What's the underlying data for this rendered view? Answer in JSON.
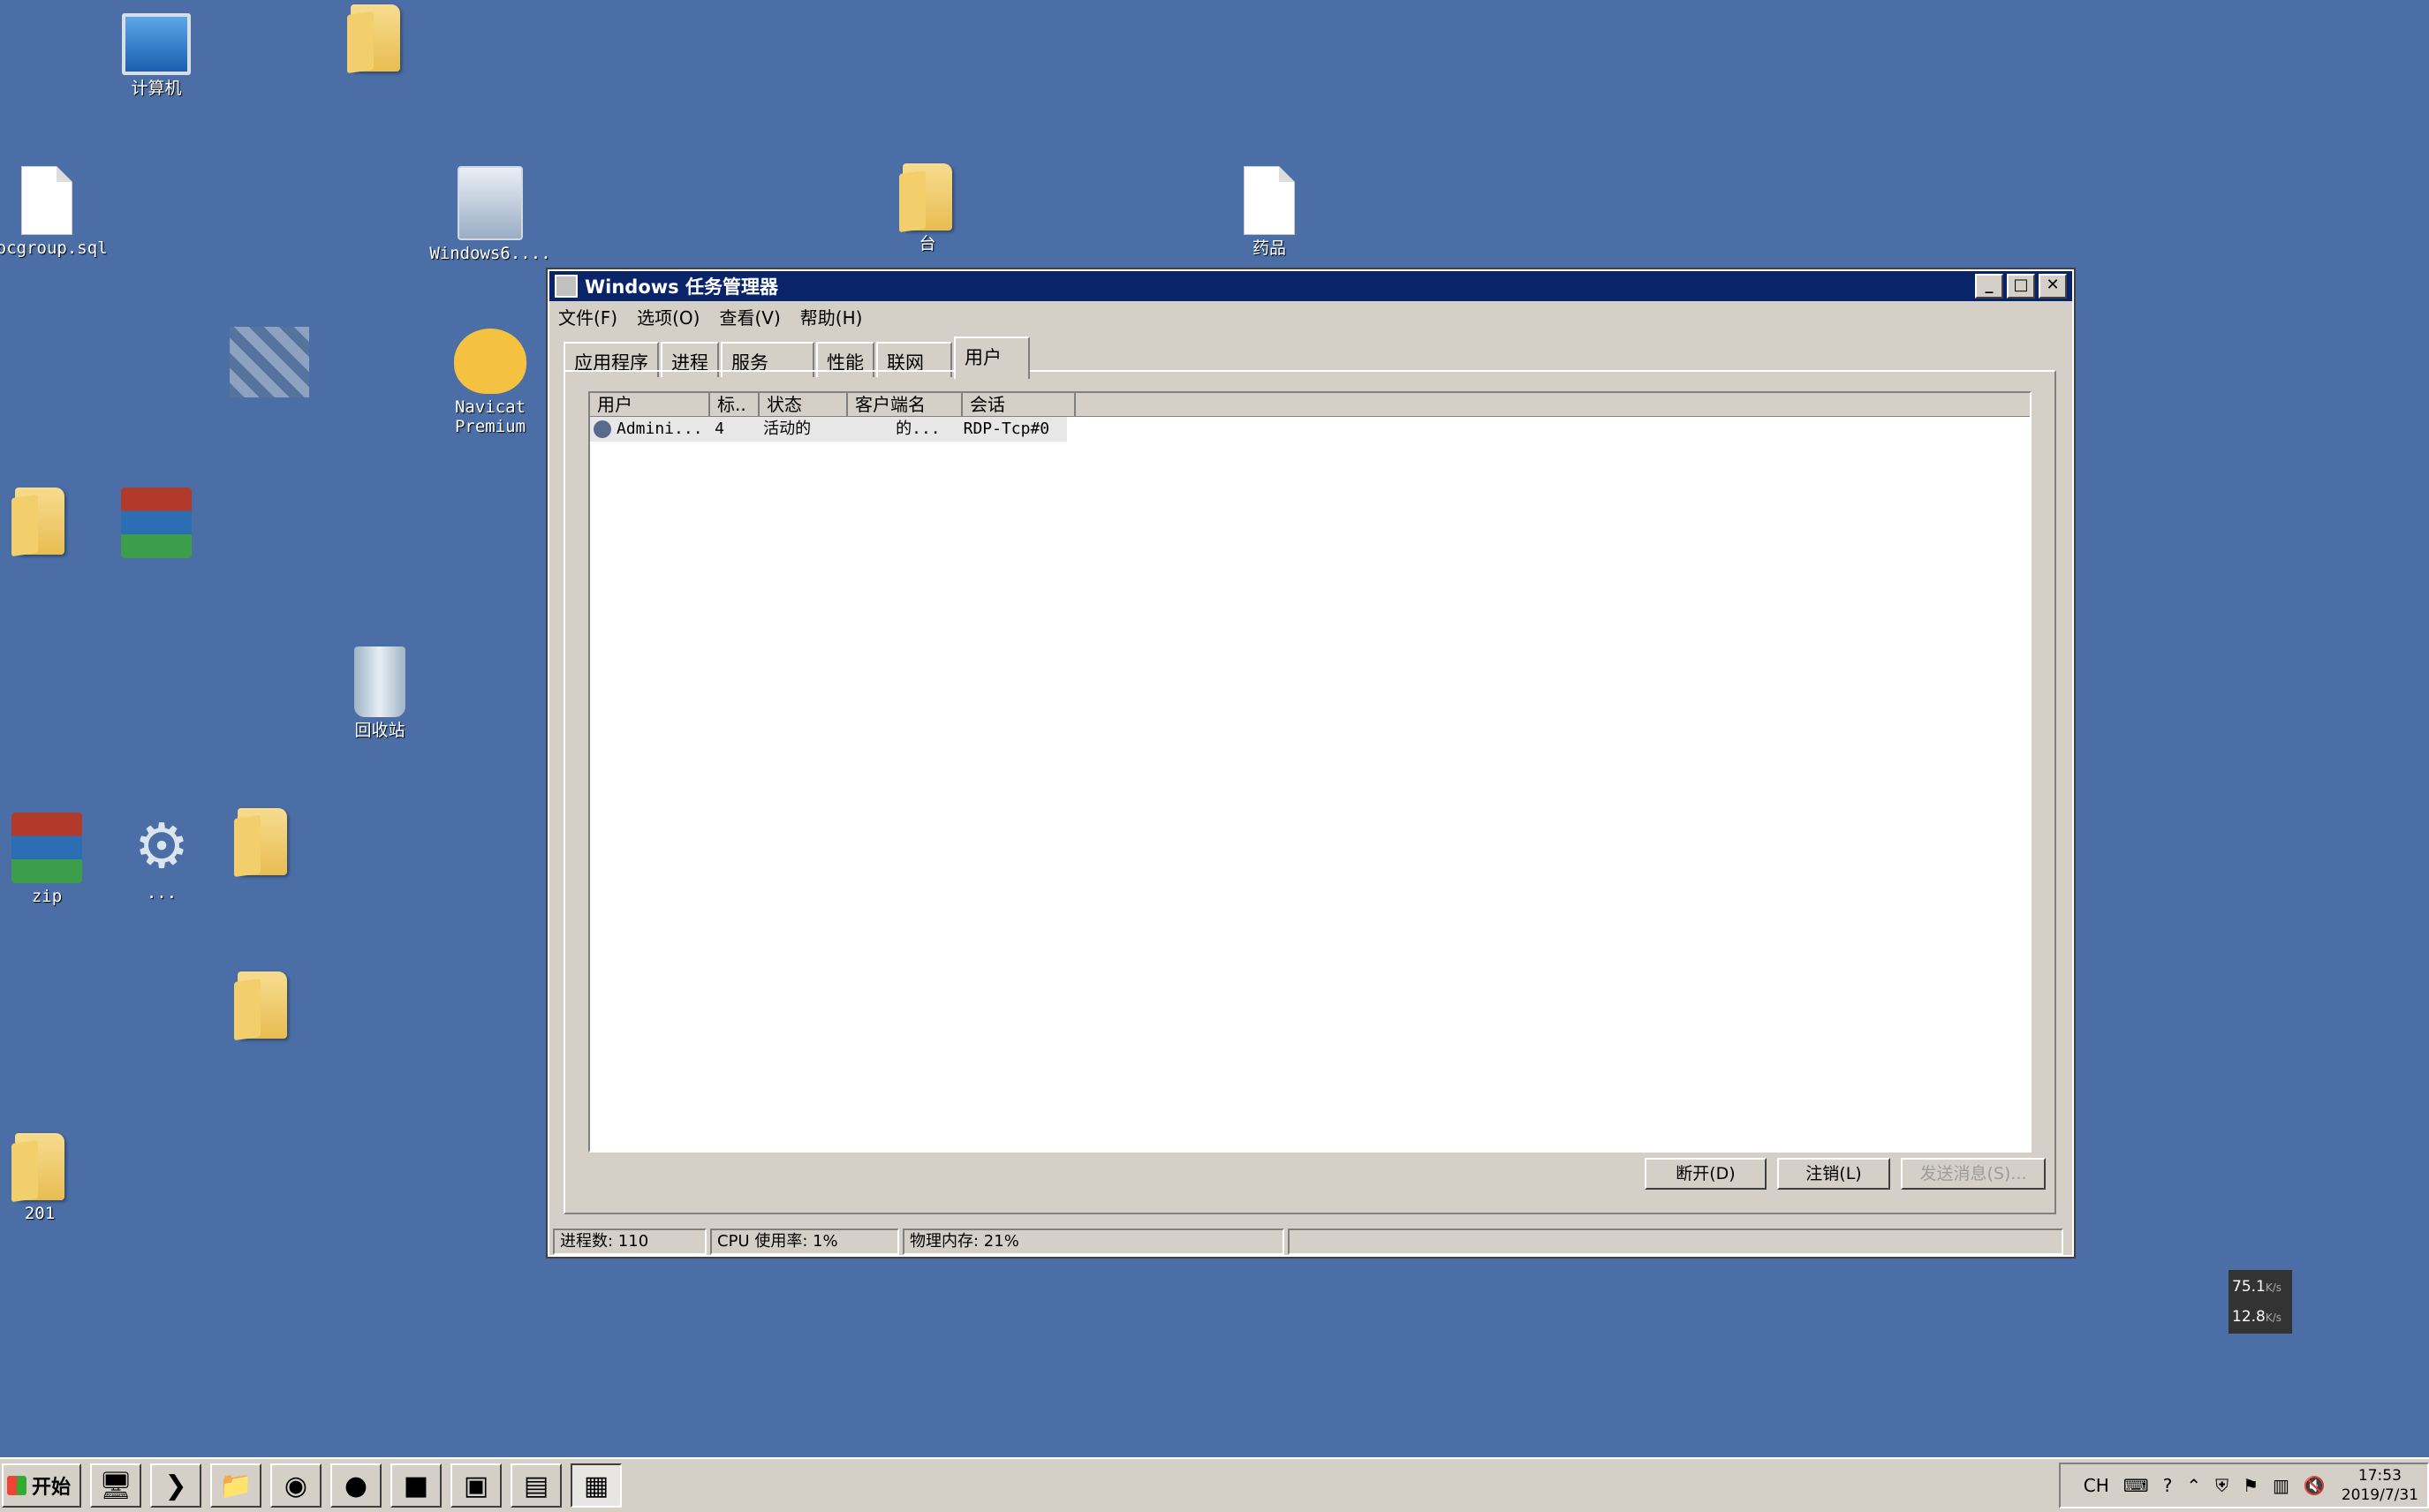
{
  "desktop": {
    "icons": [
      {
        "label": "计算机"
      },
      {
        "label": "docgroup.sql"
      },
      {
        "label": "Windows6...."
      },
      {
        "label": "台"
      },
      {
        "label": "药品"
      },
      {
        "label": "Navicat\nPremium"
      },
      {
        "label": "回收站"
      },
      {
        "label": "zip"
      },
      {
        "label": "..."
      },
      {
        "label": "201"
      }
    ]
  },
  "window": {
    "title": "Windows 任务管理器",
    "menu": [
      "文件(F)",
      "选项(O)",
      "查看(V)",
      "帮助(H)"
    ],
    "tabs": [
      "应用程序",
      "进程",
      "服务",
      "性能",
      "联网",
      "用户"
    ],
    "active_tab": "用户",
    "columns": [
      "用户",
      "标..",
      "状态",
      "客户端名",
      "会话"
    ],
    "rows": [
      {
        "user": "Admini...",
        "id": "4",
        "status": "活动的",
        "client": "的...",
        "session": "RDP-Tcp#0"
      }
    ],
    "buttons": {
      "disconnect": "断开(D)",
      "logoff": "注销(L)",
      "send_message": "发送消息(S)..."
    },
    "status": {
      "processes": "进程数: 110",
      "cpu": "CPU 使用率: 1%",
      "memory": "物理内存: 21%"
    }
  },
  "netspeed": {
    "up": "75.1",
    "down": "12.8",
    "unit": "K/s"
  },
  "taskbar": {
    "start_label": "开始",
    "tray": {
      "lang": "CH",
      "time": "17:53",
      "date": "2019/7/31"
    }
  },
  "colors": {
    "desktop": "#4a6ea5",
    "titlebar": "#0a246a",
    "face": "#d4d0c8"
  }
}
